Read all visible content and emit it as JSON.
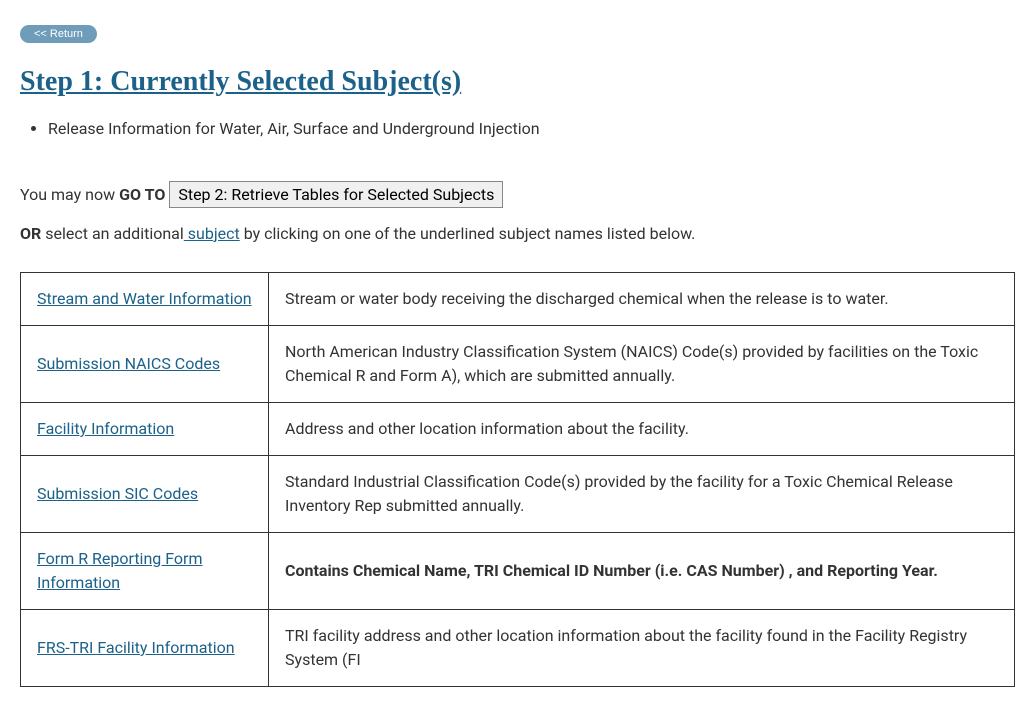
{
  "returnButton": "<< Return",
  "heading": "Step 1: Currently Selected Subject(s)",
  "selectedSubjects": [
    "Release Information for Water, Air, Surface and Underground Injection"
  ],
  "gotoPrefix": "You may now ",
  "gotoBold": "GO TO",
  "step2Button": "Step 2: Retrieve Tables for Selected Subjects",
  "orBold": "OR",
  "orText1": " select an additional",
  "subjectLink": " subject",
  "orText2": " by clicking on one of the underlined subject names listed below.",
  "subjects": [
    {
      "name": "Stream and Water Information",
      "desc": "Stream or water body receiving the discharged chemical when the release is to water.",
      "bold": false
    },
    {
      "name": "Submission NAICS Codes",
      "desc": "North American Industry Classification System (NAICS) Code(s) provided by facilities on the Toxic Chemical R and Form A), which are submitted annually.",
      "bold": false
    },
    {
      "name": "Facility Information",
      "desc": "Address and other location information about the facility.",
      "bold": false
    },
    {
      "name": "Submission SIC Codes",
      "desc": "Standard Industrial Classification Code(s) provided by the facility for a Toxic Chemical Release Inventory Rep submitted annually.",
      "bold": false
    },
    {
      "name": "Form R Reporting Form Information",
      "desc": "Contains Chemical Name, TRI Chemical ID Number (i.e. CAS Number) , and Reporting Year.",
      "bold": true
    },
    {
      "name": "FRS-TRI Facility Information",
      "desc": "TRI facility address and other location information about the facility found in the Facility Registry System (FI",
      "bold": false
    }
  ]
}
